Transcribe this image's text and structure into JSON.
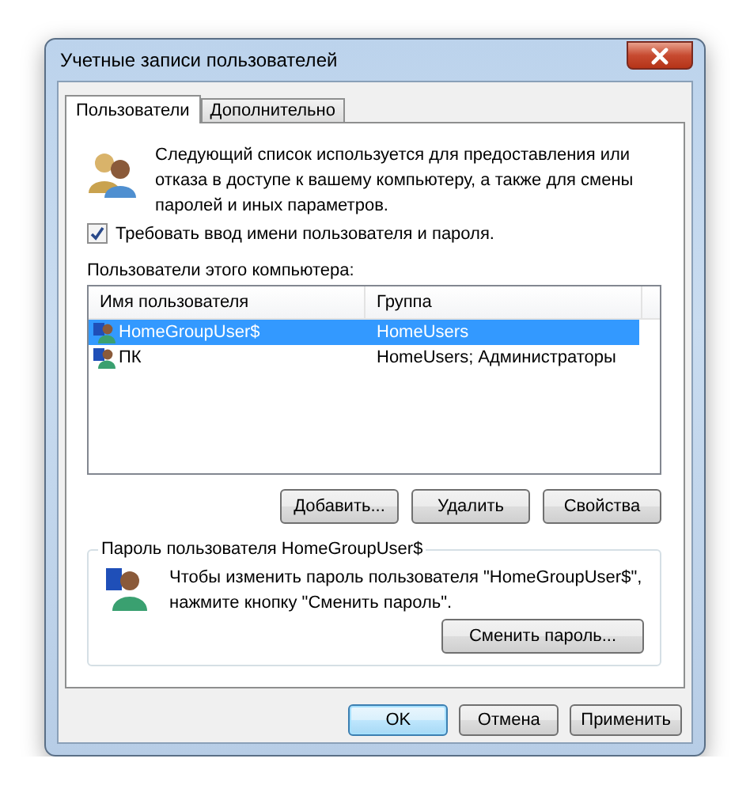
{
  "window": {
    "title": "Учетные записи пользователей"
  },
  "tabs": [
    {
      "label": "Пользователи",
      "selected": true
    },
    {
      "label": "Дополнительно",
      "selected": false
    }
  ],
  "intro": {
    "text": "Следующий список используется для предоставления или отказа в доступе к вашему компьютеру, а также для смены паролей и иных параметров."
  },
  "require_password": {
    "label": "Требовать ввод имени пользователя и пароля.",
    "checked": true
  },
  "users_label": "Пользователи этого компьютера:",
  "user_list": {
    "columns": [
      "Имя пользователя",
      "Группа"
    ],
    "rows": [
      {
        "name": "HomeGroupUser$",
        "group": "HomeUsers",
        "selected": true
      },
      {
        "name": "ПК",
        "group": "HomeUsers; Администраторы",
        "selected": false
      }
    ]
  },
  "user_buttons": [
    "Добавить...",
    "Удалить",
    "Свойства"
  ],
  "password_group": {
    "title": "Пароль пользователя HomeGroupUser$",
    "text": "Чтобы изменить пароль пользователя \"HomeGroupUser$\", нажмите кнопку \"Сменить пароль\".",
    "button": "Сменить пароль..."
  },
  "dialog_buttons": [
    {
      "label": "OK",
      "default": true
    },
    {
      "label": "Отмена",
      "default": false
    },
    {
      "label": "Применить",
      "default": false
    }
  ]
}
